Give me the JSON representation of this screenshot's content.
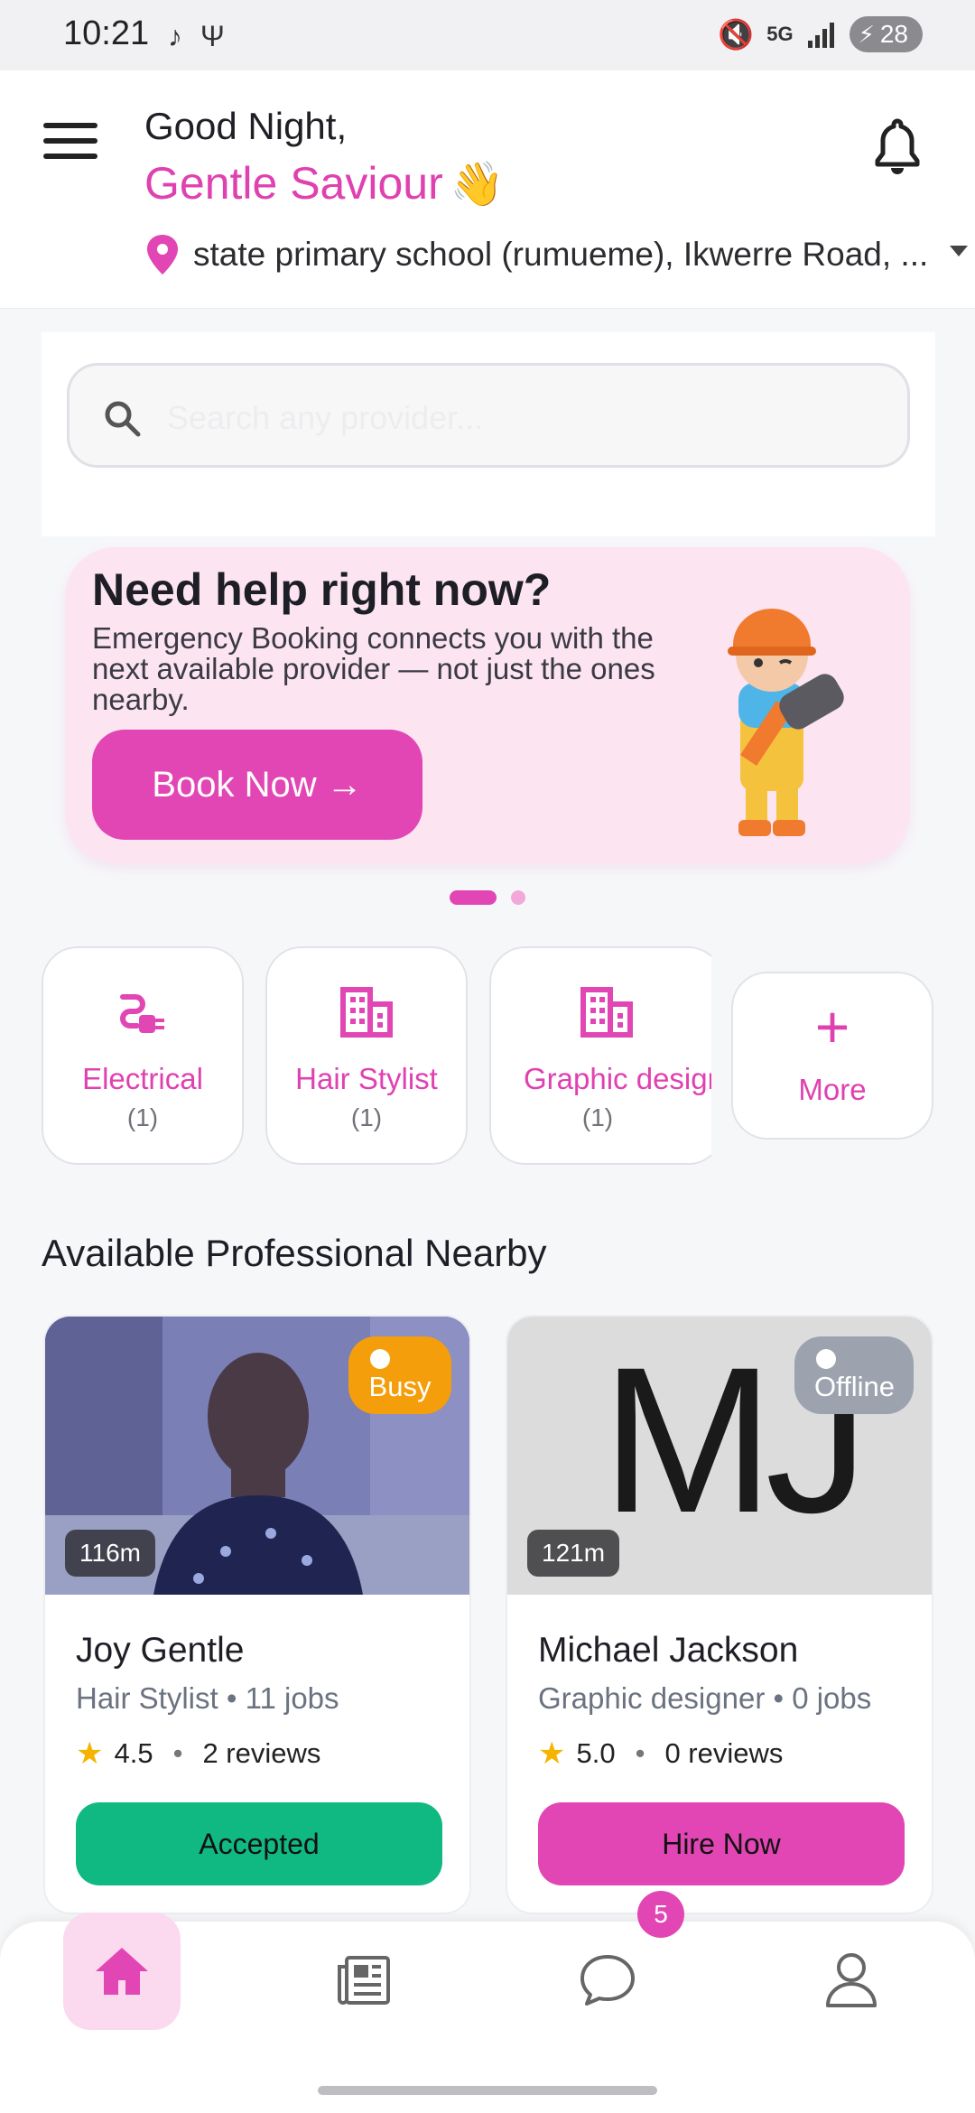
{
  "status_bar": {
    "time": "10:21",
    "battery": "28",
    "left_icons": [
      "tiktok-icon",
      "usb-icon"
    ],
    "right_icons": [
      "mute-icon",
      "5g-icon",
      "signal-icon"
    ]
  },
  "header": {
    "greeting": "Good Night,",
    "user_name": "Gentle Saviour",
    "wave_emoji": "👋",
    "location": "state primary school (rumueme), Ikwerre Road, ..."
  },
  "search": {
    "placeholder": "Search any provider..."
  },
  "promo": {
    "title": "Need help right now?",
    "text": "Emergency Booking connects you with the next available provider — not just the ones nearby.",
    "button_label": "Book Now →",
    "slide_index": 1,
    "slide_count": 2
  },
  "categories": [
    {
      "name": "Electrical",
      "count": "(1)",
      "icon": "plug-icon"
    },
    {
      "name": "Hair Stylist",
      "count": "(1)",
      "icon": "building-icon"
    },
    {
      "name": "Graphic designer",
      "count": "(1)",
      "icon": "building-icon"
    }
  ],
  "more_label": "More",
  "section_title": "Available Professional Nearby",
  "professionals": [
    {
      "name": "Joy Gentle",
      "meta": "Hair Stylist • 11 jobs",
      "rating": "4.5",
      "reviews": "2 reviews",
      "status": "Busy",
      "distance": "116m",
      "button_label": "Accepted",
      "status_color": "#f59e0b",
      "button_color": "#10b981"
    },
    {
      "name": "Michael Jackson",
      "meta": "Graphic designer • 0 jobs",
      "rating": "5.0",
      "reviews": "0 reviews",
      "status": "Offline",
      "distance": "121m",
      "initials": "MJ",
      "button_label": "Hire Now",
      "status_color": "#9ca3af",
      "button_color": "#e146b4"
    }
  ],
  "bottom_nav": {
    "items": [
      "home-icon",
      "news-icon",
      "chat-icon",
      "profile-icon"
    ],
    "active": "home-icon",
    "chat_badge": "5"
  },
  "colors": {
    "accent": "#e146b4",
    "accent_light": "#fce4f1"
  }
}
